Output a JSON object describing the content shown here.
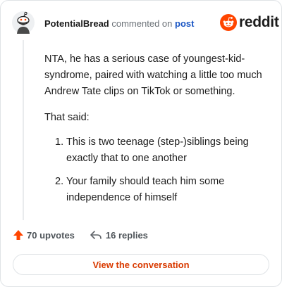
{
  "comment": {
    "username": "PotentialBread",
    "commented_on_text": "commented on",
    "post_link": "post",
    "body": {
      "paragraph_1": "NTA, he has a serious case of youngest-kid-syndrome, paired with watching a little too much Andrew Tate clips on TikTok or something.",
      "paragraph_2": "That said:",
      "list": [
        {
          "number": "1.",
          "text": "This is two teenage (step-)siblings being exactly that to one another"
        },
        {
          "number": "2.",
          "text": "Your family should teach him some independence of himself"
        }
      ]
    }
  },
  "brand": {
    "name": "reddit",
    "icon": "reddit-snoo-icon",
    "color": "#ff4500"
  },
  "stats": {
    "upvotes_label": "70 upvotes",
    "upvote_icon": "upvote-arrow-icon",
    "upvote_color": "#ff4500",
    "replies_label": "16 replies",
    "reply_icon": "reply-arrow-icon"
  },
  "cta": {
    "label": "View the conversation",
    "color": "#d93a00"
  },
  "avatar": {
    "icon": "snoo-avatar-icon"
  }
}
